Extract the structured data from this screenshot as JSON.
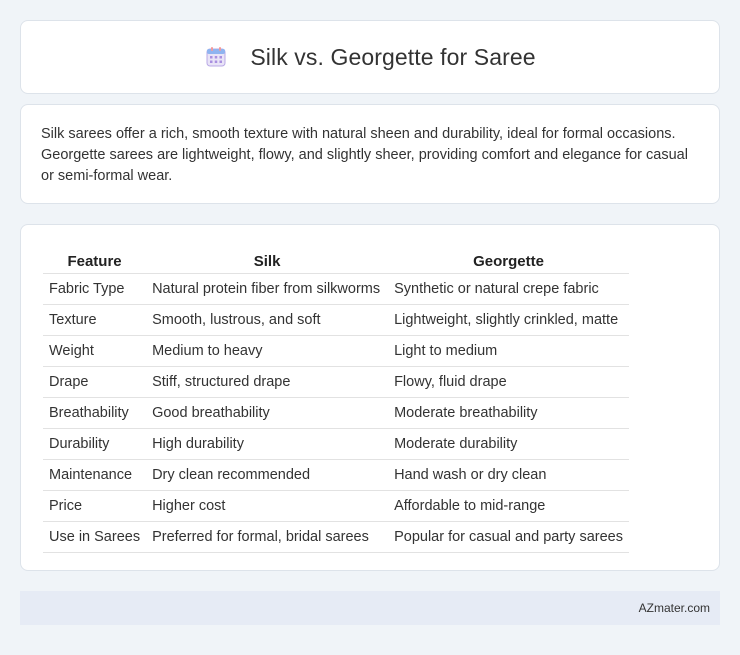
{
  "header": {
    "title": "Silk vs. Georgette for Saree",
    "icon": "calendar-icon"
  },
  "description": "Silk sarees offer a rich, smooth texture with natural sheen and durability, ideal for formal occasions. Georgette sarees are lightweight, flowy, and slightly sheer, providing comfort and elegance for casual or semi-formal wear.",
  "table": {
    "headers": [
      "Feature",
      "Silk",
      "Georgette"
    ],
    "rows": [
      [
        "Fabric Type",
        "Natural protein fiber from silkworms",
        "Synthetic or natural crepe fabric"
      ],
      [
        "Texture",
        "Smooth, lustrous, and soft",
        "Lightweight, slightly crinkled, matte"
      ],
      [
        "Weight",
        "Medium to heavy",
        "Light to medium"
      ],
      [
        "Drape",
        "Stiff, structured drape",
        "Flowy, fluid drape"
      ],
      [
        "Breathability",
        "Good breathability",
        "Moderate breathability"
      ],
      [
        "Durability",
        "High durability",
        "Moderate durability"
      ],
      [
        "Maintenance",
        "Dry clean recommended",
        "Hand wash or dry clean"
      ],
      [
        "Price",
        "Higher cost",
        "Affordable to mid-range"
      ],
      [
        "Use in Sarees",
        "Preferred for formal, bridal sarees",
        "Popular for casual and party sarees"
      ]
    ]
  },
  "footer": {
    "brand": "AZmater.com"
  }
}
